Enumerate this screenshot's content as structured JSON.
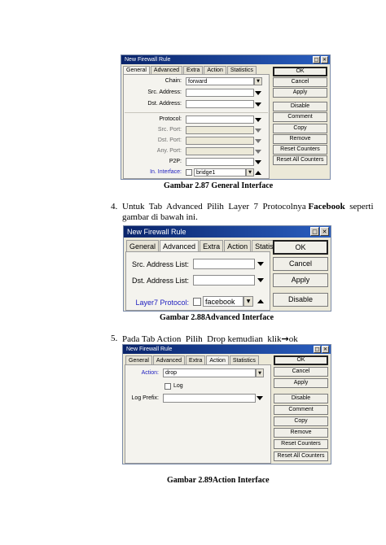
{
  "figure1": {
    "title": "New Firewall Rule",
    "tabs": [
      "General",
      "Advanced",
      "Extra",
      "Action",
      "Statistics"
    ],
    "fields": {
      "chain_label": "Chain:",
      "chain_value": "forward",
      "src_address_label": "Src. Address:",
      "dst_address_label": "Dst. Address:",
      "protocol_label": "Protocol:",
      "src_port_label": "Src. Port:",
      "dst_port_label": "Dst. Port:",
      "any_port_label": "Any. Port:",
      "p2p_label": "P2P:",
      "in_interface_label": "In. Interface:",
      "in_interface_value": "bridge1"
    },
    "buttons": [
      "OK",
      "Cancel",
      "Apply",
      "Disable",
      "Comment",
      "Copy",
      "Remove",
      "Reset Counters",
      "Reset All Counters"
    ],
    "caption": "Gambar  2.87 General Interface"
  },
  "step4": {
    "number": "4.",
    "line1_pre": "Untuk  Tab  Advanced  Pilih  Layer  7  Protocolnya ",
    "line1_bold": "Facebook",
    "line1_post": "  seperti",
    "line2": "gambar di bawah ini."
  },
  "figure2": {
    "title": "New Firewall Rule",
    "tabs": [
      "General",
      "Advanced",
      "Extra",
      "Action",
      "Statistics"
    ],
    "fields": {
      "src_address_list_label": "Src. Address List:",
      "dst_address_list_label": "Dst. Address List:",
      "layer7_label": "Layer7 Protocol:",
      "layer7_value": "facebook"
    },
    "buttons": [
      "OK",
      "Cancel",
      "Apply",
      "Disable"
    ],
    "caption": "Gambar  2.88Advanced Interface"
  },
  "step5": {
    "number": "5.",
    "text_pre": "Pada Tab Action  Pilih  Drop kemudian  klik",
    "arrow": "→",
    "text_post": "ok"
  },
  "figure3": {
    "title": "New Firewall Rule",
    "tabs": [
      "General",
      "Advanced",
      "Extra",
      "Action",
      "Statistics"
    ],
    "fields": {
      "action_label": "Action:",
      "action_value": "drop",
      "log_label": "Log",
      "log_prefix_label": "Log Prefix:"
    },
    "buttons": [
      "OK",
      "Cancel",
      "Apply",
      "Disable",
      "Comment",
      "Copy",
      "Remove",
      "Reset Counters",
      "Reset All Counters"
    ],
    "caption": "Gambar  2.89Action Interface"
  }
}
